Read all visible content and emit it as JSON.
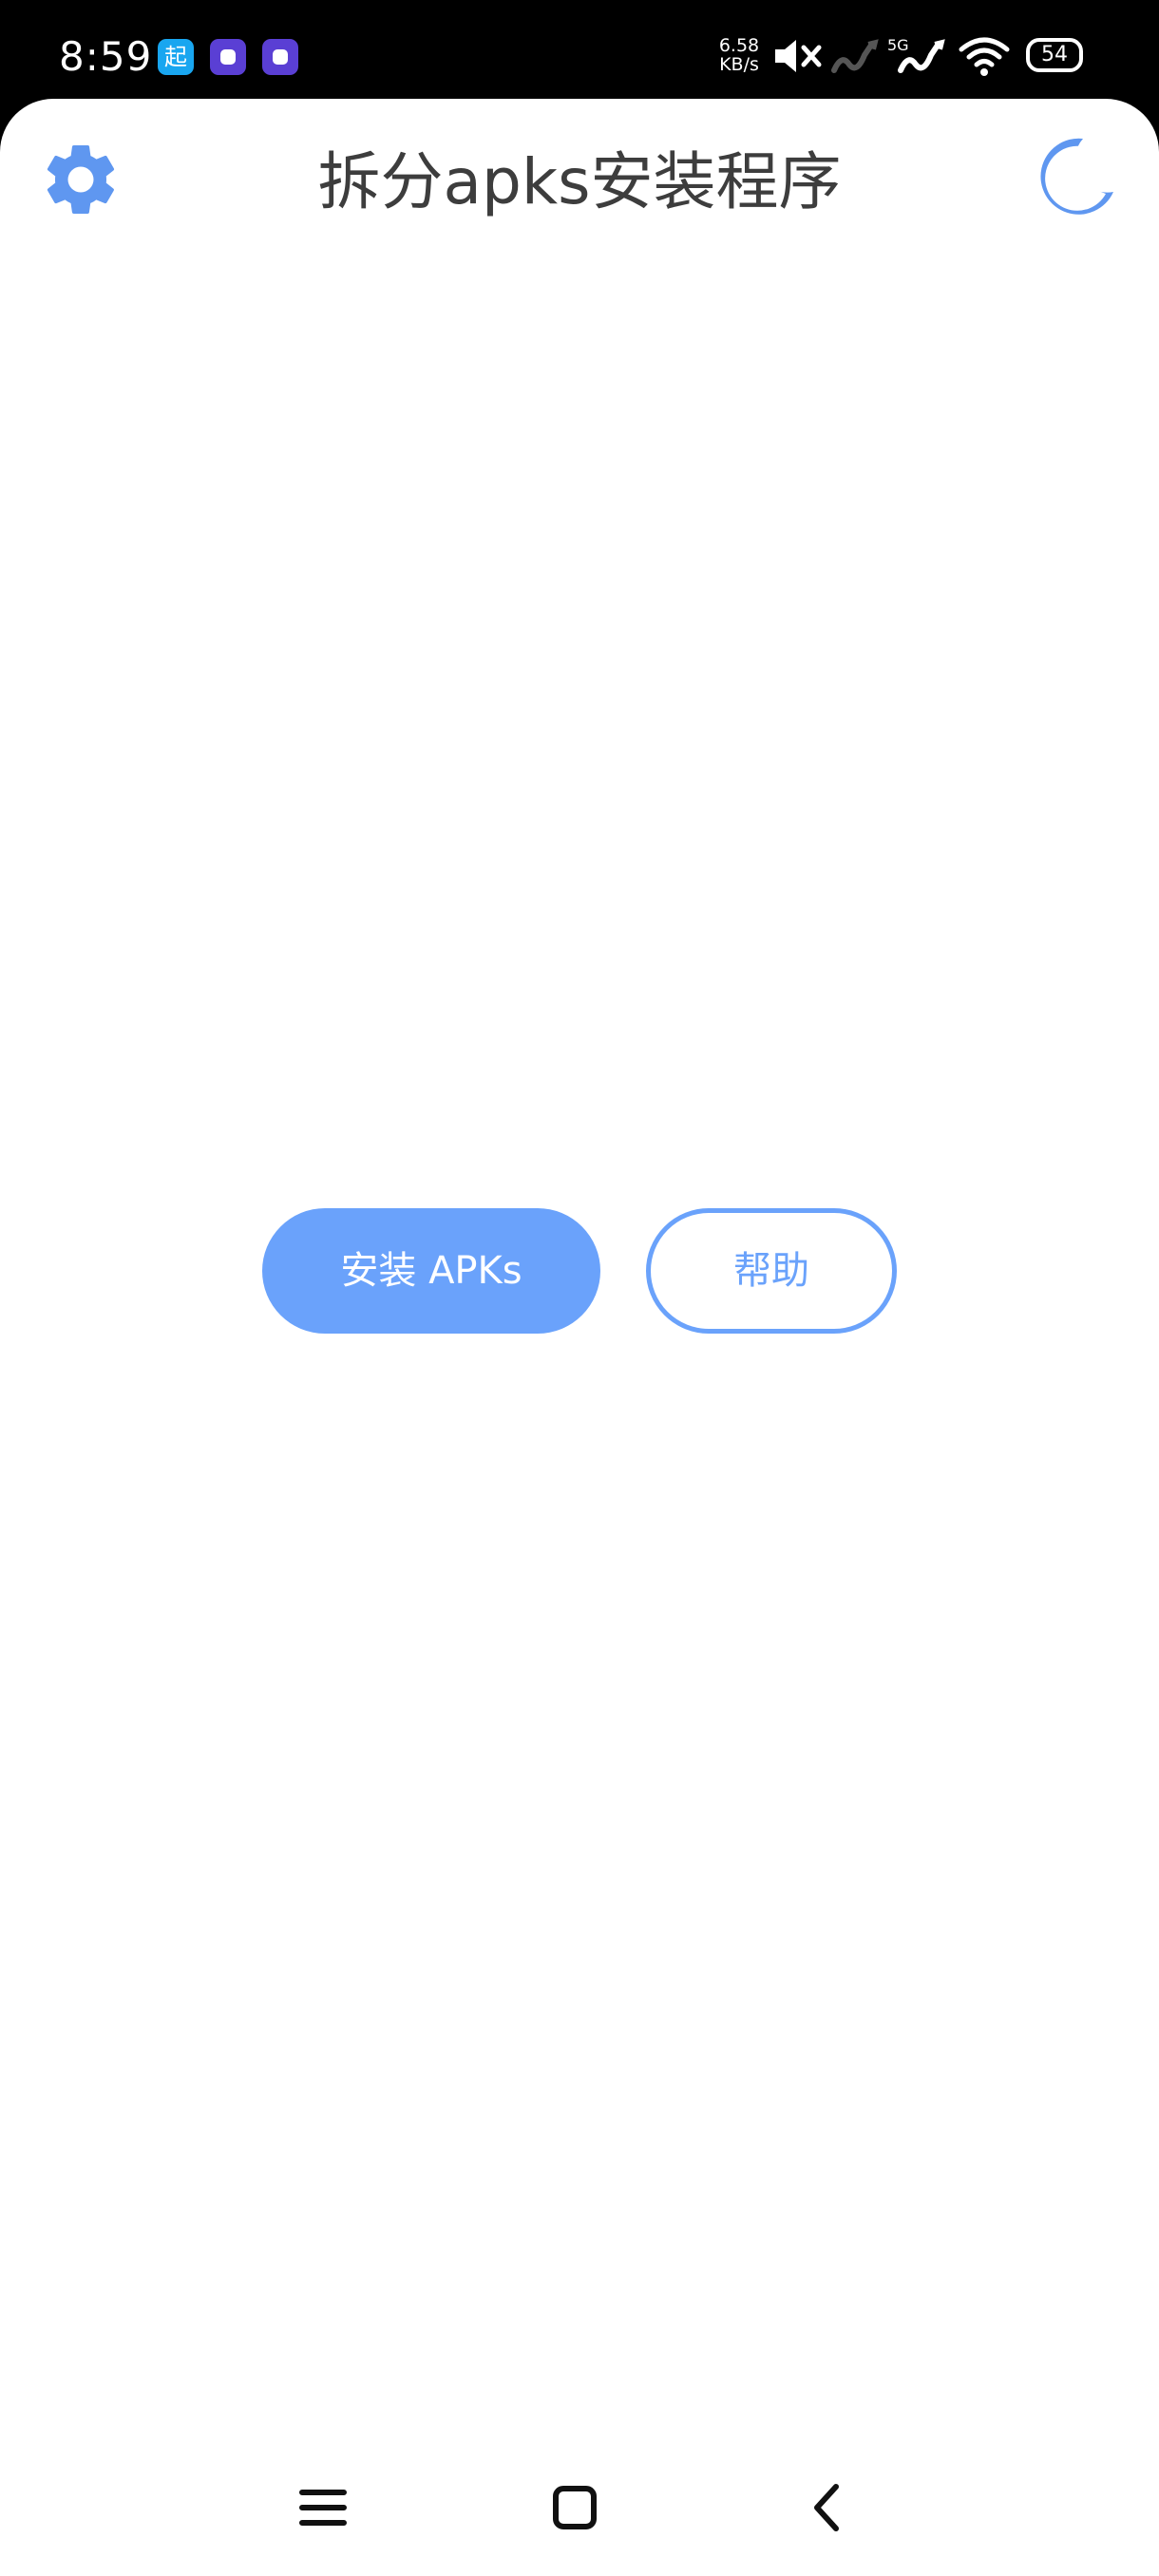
{
  "status_bar": {
    "time": "8:59",
    "app1_glyph": "起",
    "net_speed_value": "6.58",
    "net_speed_unit": "KB/s",
    "signal_label": "5G",
    "battery_level": "54",
    "icons": [
      "mute-icon",
      "signal-1-icon",
      "signal-2-icon",
      "wifi-icon",
      "battery-icon"
    ]
  },
  "header": {
    "title": "拆分apks安装程序",
    "settings_icon": "gear-icon",
    "theme_icon": "moon-icon"
  },
  "main": {
    "install_button": "安装 APKs",
    "help_button": "帮助"
  },
  "nav_bar": {
    "icons": [
      "menu-icon",
      "home-icon",
      "back-icon"
    ]
  },
  "colors": {
    "accent": "#6aa2fb",
    "title_text": "#3d3d3d",
    "background": "#ffffff",
    "status_bar": "#000000"
  }
}
